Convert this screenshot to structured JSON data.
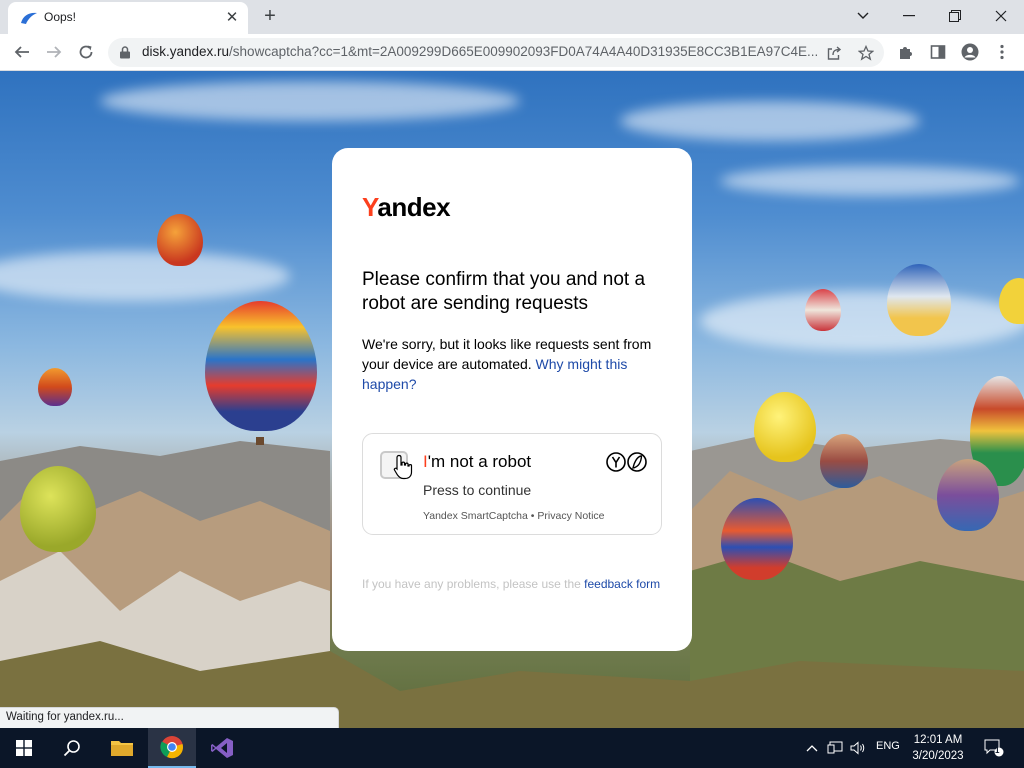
{
  "browser": {
    "tab_title": "Oops!",
    "url_host": "disk.yandex.ru",
    "url_path": "/showcaptcha?cc=1&mt=2A009299D665E009902093FD0A74A4A40D31935E8CC3B1EA97C4E...",
    "status_text": "Waiting for yandex.ru..."
  },
  "captcha": {
    "logo_first": "Y",
    "logo_rest": "andex",
    "heading": "Please confirm that you and not a robot are sending requests",
    "desc_text": "We're sorry, but it looks like requests sent from your device are automated. ",
    "desc_link": "Why might this happen?",
    "robot_first": "I",
    "robot_rest": "'m not a robot",
    "press_label": "Press to continue",
    "smartcaptcha_link": "Yandex SmartCaptcha",
    "separator": " • ",
    "privacy_link": "Privacy Notice",
    "feedback_text": "If you have any problems, please use the ",
    "feedback_link": "feedback form"
  },
  "taskbar": {
    "language": "ENG",
    "time": "12:01 AM",
    "date": "3/20/2023",
    "notification_count": "1"
  },
  "colors": {
    "yandex_red": "#fc3f1d",
    "link_blue": "#1e4aa8",
    "taskbar_bg": "#0b1628"
  }
}
